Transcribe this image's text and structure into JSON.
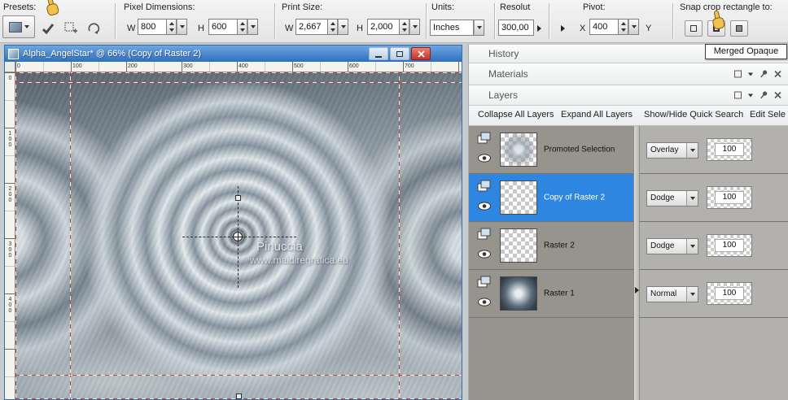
{
  "toolbar": {
    "presets_label": "Presets:",
    "pixel_dimensions_label": "Pixel Dimensions:",
    "w_label": "W",
    "h_label": "H",
    "pixel_w": "800",
    "pixel_h": "600",
    "print_size_label": "Print Size:",
    "print_w": "2,667",
    "print_h": "2,000",
    "units_label": "Units:",
    "units_value": "Inches",
    "resolution_label": "Resolut",
    "resolution_value": "300,00",
    "pivot_label": "Pivot:",
    "pivot_x_label": "X",
    "pivot_x": "400",
    "pivot_y_label": "Y",
    "snap_label": "Snap crop rectangle to:",
    "tooltip": "Merged Opaque"
  },
  "doc": {
    "title": "Alpha_AngelStar* @ 66% (Copy of Raster 2)",
    "ruler_h": [
      "0",
      "100",
      "200",
      "300",
      "400",
      "500",
      "600",
      "700"
    ],
    "ruler_v": [
      "0",
      "100",
      "200",
      "300",
      "400"
    ],
    "watermark_line1": "Pinuccia",
    "watermark_line2": "www.maidiregrafica.eu"
  },
  "panels": {
    "history_title": "History",
    "materials_title": "Materials",
    "layers_title": "Layers",
    "layers_toolbar": {
      "collapse": "Collapse All Layers",
      "expand": "Expand All Layers",
      "quick_search": "Show/Hide Quick Search",
      "edit": "Edit Sele"
    },
    "layer_rows": [
      {
        "name": "Promoted Selection",
        "blend": "Overlay",
        "opacity": "100"
      },
      {
        "name": "Copy of Raster 2",
        "blend": "Dodge",
        "opacity": "100"
      },
      {
        "name": "Raster 2",
        "blend": "Dodge",
        "opacity": "100"
      },
      {
        "name": "Raster 1",
        "blend": "Normal",
        "opacity": "100"
      }
    ]
  },
  "colors": {
    "selected_layer": "#2f86e0",
    "titlebar_blue": "#2f6fbe",
    "cursor_yellow": "#f2c14e",
    "crop_guide_red": "#c0453a"
  }
}
